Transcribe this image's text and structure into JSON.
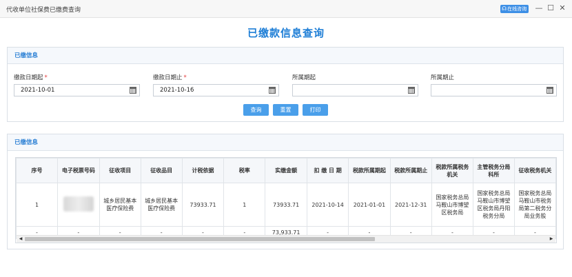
{
  "window": {
    "title": "代收单位社保费已缴费查询",
    "online_label": "在线咨询",
    "min_label": "—",
    "max_label": "☐",
    "close_label": "✕"
  },
  "page_title": "已缴款信息查询",
  "filter_panel": {
    "header": "已缴信息",
    "fields": [
      {
        "label": "缴款日期起",
        "required": "*",
        "value": "2021-10-01"
      },
      {
        "label": "缴款日期止",
        "required": "*",
        "value": "2021-10-16"
      },
      {
        "label": "所属期起",
        "required": "",
        "value": ""
      },
      {
        "label": "所属期止",
        "required": "",
        "value": ""
      }
    ],
    "buttons": {
      "query": "查询",
      "reset": "重置",
      "print": "打印"
    }
  },
  "result_panel": {
    "header": "已缴信息",
    "columns": [
      "序号",
      "电子税票号码",
      "征收项目",
      "征收品目",
      "计税依据",
      "税率",
      "实缴金额",
      "扣 缴 日 期",
      "税款所属期起",
      "税款所属期止",
      "税款所属税务机关",
      "主管税务分局科所",
      "征收税务机关"
    ],
    "rows": [
      [
        "1",
        "",
        "城乡居民基本医疗保险费",
        "城乡居民基本医疗保险费",
        "73933.71",
        "1",
        "73933.71",
        "2021-10-14",
        "2021-01-01",
        "2021-12-31",
        "国家税务总局马鞍山市博望区税务局",
        "国家税务总局马鞍山市博望区税务局丹阳税务分局",
        "国家税务总局马鞍山市税务局第二税务分局业务股"
      ]
    ],
    "totals": [
      "-",
      "-",
      "-",
      "-",
      "-",
      "-",
      "73,933.71",
      "-",
      "-",
      "-",
      "-",
      "-",
      "-"
    ]
  },
  "icons": [
    "headset-icon",
    "minimize-icon",
    "maximize-icon",
    "close-icon",
    "calendar-icon",
    "scroll-left-icon",
    "scroll-right-icon"
  ]
}
